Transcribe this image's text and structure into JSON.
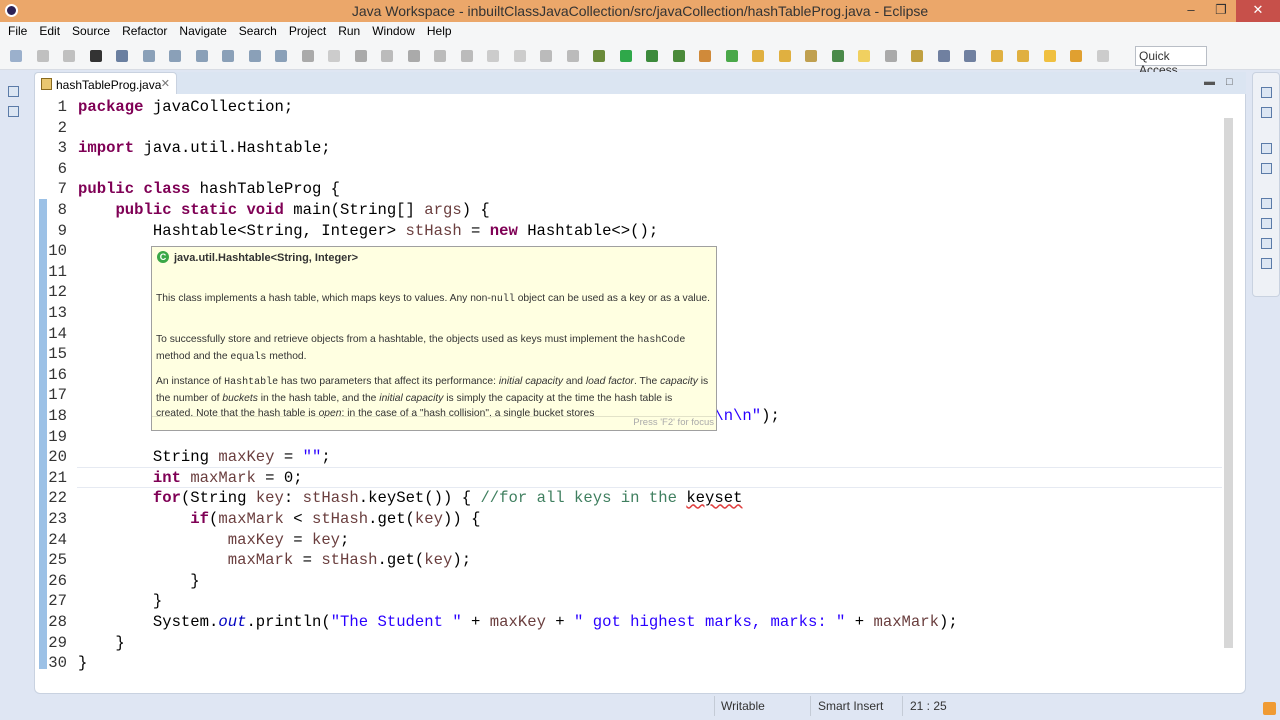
{
  "window": {
    "title": "Java Workspace - inbuiltClassJavaCollection/src/javaCollection/hashTableProg.java - Eclipse"
  },
  "menu": [
    "File",
    "Edit",
    "Source",
    "Refactor",
    "Navigate",
    "Search",
    "Project",
    "Run",
    "Window",
    "Help"
  ],
  "toolbar": {
    "quick_access": "Quick Access"
  },
  "editor": {
    "tab_label": "hashTableProg.java",
    "current_line": 21,
    "lines": [
      {
        "n": "1",
        "tokens": [
          [
            "kw",
            "package"
          ],
          [
            "pl",
            " javaCollection;"
          ]
        ]
      },
      {
        "n": "2",
        "tokens": []
      },
      {
        "n": "3",
        "tokens": [
          [
            "kw",
            "import"
          ],
          [
            "pl",
            " java.util.Hashtable;"
          ]
        ]
      },
      {
        "n": "6",
        "tokens": []
      },
      {
        "n": "7",
        "tokens": [
          [
            "kw",
            "public class"
          ],
          [
            "pl",
            " hashTableProg {"
          ]
        ]
      },
      {
        "n": "8",
        "tokens": [
          [
            "pl",
            "    "
          ],
          [
            "kw",
            "public static void"
          ],
          [
            "pl",
            " main(String[] "
          ],
          [
            "var",
            "args"
          ],
          [
            "pl",
            ") {"
          ]
        ]
      },
      {
        "n": "9",
        "tokens": [
          [
            "pl",
            "        Hashtable<String, Integer> "
          ],
          [
            "var",
            "stHash"
          ],
          [
            "pl",
            " = "
          ],
          [
            "kw",
            "new"
          ],
          [
            "pl",
            " Hashtable<>();"
          ]
        ]
      },
      {
        "n": "10",
        "tokens": []
      },
      {
        "n": "11",
        "tokens": []
      },
      {
        "n": "12",
        "tokens": []
      },
      {
        "n": "13",
        "tokens": []
      },
      {
        "n": "14",
        "tokens": []
      },
      {
        "n": "15",
        "tokens": []
      },
      {
        "n": "16",
        "tokens": []
      },
      {
        "n": "17",
        "tokens": []
      },
      {
        "n": "18",
        "tokens": [
          [
            "pl",
            "                                                                    "
          ],
          [
            "str",
            "\\n\\n\""
          ],
          [
            "pl",
            ");"
          ]
        ]
      },
      {
        "n": "19",
        "tokens": []
      },
      {
        "n": "20",
        "tokens": [
          [
            "pl",
            "        String "
          ],
          [
            "var",
            "maxKey"
          ],
          [
            "pl",
            " = "
          ],
          [
            "str",
            "\"\""
          ],
          [
            "pl",
            ";"
          ]
        ]
      },
      {
        "n": "21",
        "tokens": [
          [
            "pl",
            "        "
          ],
          [
            "kw",
            "int"
          ],
          [
            "pl",
            " "
          ],
          [
            "var",
            "maxMark"
          ],
          [
            "pl",
            " = 0;"
          ]
        ]
      },
      {
        "n": "22",
        "tokens": [
          [
            "pl",
            "        "
          ],
          [
            "kw",
            "for"
          ],
          [
            "pl",
            "(String "
          ],
          [
            "var",
            "key"
          ],
          [
            "pl",
            ": "
          ],
          [
            "var",
            "stHash"
          ],
          [
            "pl",
            ".keySet()) { "
          ],
          [
            "com",
            "//for all keys in the "
          ],
          [
            "err",
            "keyset"
          ]
        ]
      },
      {
        "n": "23",
        "tokens": [
          [
            "pl",
            "            "
          ],
          [
            "kw",
            "if"
          ],
          [
            "pl",
            "("
          ],
          [
            "var",
            "maxMark"
          ],
          [
            "pl",
            " < "
          ],
          [
            "var",
            "stHash"
          ],
          [
            "pl",
            ".get("
          ],
          [
            "var",
            "key"
          ],
          [
            "pl",
            ")) {"
          ]
        ]
      },
      {
        "n": "24",
        "tokens": [
          [
            "pl",
            "                "
          ],
          [
            "var",
            "maxKey"
          ],
          [
            "pl",
            " = "
          ],
          [
            "var",
            "key"
          ],
          [
            "pl",
            ";"
          ]
        ]
      },
      {
        "n": "25",
        "tokens": [
          [
            "pl",
            "                "
          ],
          [
            "var",
            "maxMark"
          ],
          [
            "pl",
            " = "
          ],
          [
            "var",
            "stHash"
          ],
          [
            "pl",
            ".get("
          ],
          [
            "var",
            "key"
          ],
          [
            "pl",
            ");"
          ]
        ]
      },
      {
        "n": "26",
        "tokens": [
          [
            "pl",
            "            }"
          ]
        ]
      },
      {
        "n": "27",
        "tokens": [
          [
            "pl",
            "        }"
          ]
        ]
      },
      {
        "n": "28",
        "tokens": [
          [
            "pl",
            "        System."
          ],
          [
            "fld",
            "out"
          ],
          [
            "pl",
            ".println("
          ],
          [
            "str",
            "\"The Student \""
          ],
          [
            "pl",
            " + "
          ],
          [
            "var",
            "maxKey"
          ],
          [
            "pl",
            " + "
          ],
          [
            "str",
            "\" got highest marks, marks: \""
          ],
          [
            "pl",
            " + "
          ],
          [
            "var",
            "maxMark"
          ],
          [
            "pl",
            ");"
          ]
        ]
      },
      {
        "n": "29",
        "tokens": [
          [
            "pl",
            "    }"
          ]
        ]
      },
      {
        "n": "30",
        "tokens": [
          [
            "pl",
            "}"
          ]
        ]
      }
    ]
  },
  "tooltip": {
    "header": "java.util.Hashtable<String, Integer>",
    "p1a": "This class implements a hash table, which maps keys to values. Any non-",
    "p1code": "null",
    "p1b": " object can be used as a key or as a value.",
    "p2a": "To successfully store and retrieve objects from a hashtable, the objects used as keys must implement the ",
    "p2code1": "hashCode",
    "p2b": " method and the ",
    "p2code2": "equals",
    "p2c": " method.",
    "p3a": "An instance of ",
    "p3code": "Hashtable",
    "p3b": " has two parameters that affect its performance: ",
    "p3i1": "initial capacity",
    "p3c": " and ",
    "p3i2": "load factor",
    "p3d": ". The ",
    "p3i3": "capacity",
    "p3e": " is the number of ",
    "p3i4": "buckets",
    "p3f": " in the hash table, and the ",
    "p3i5": "initial capacity",
    "p3g": " is simply the capacity at the time the hash table is created. Note that the hash table is ",
    "p3i6": "open",
    "p3h": ": in the case of a \"hash collision\", a single bucket stores",
    "footer": "Press 'F2' for focus"
  },
  "status": {
    "writable": "Writable",
    "insert_mode": "Smart Insert",
    "position": "21 : 25"
  }
}
